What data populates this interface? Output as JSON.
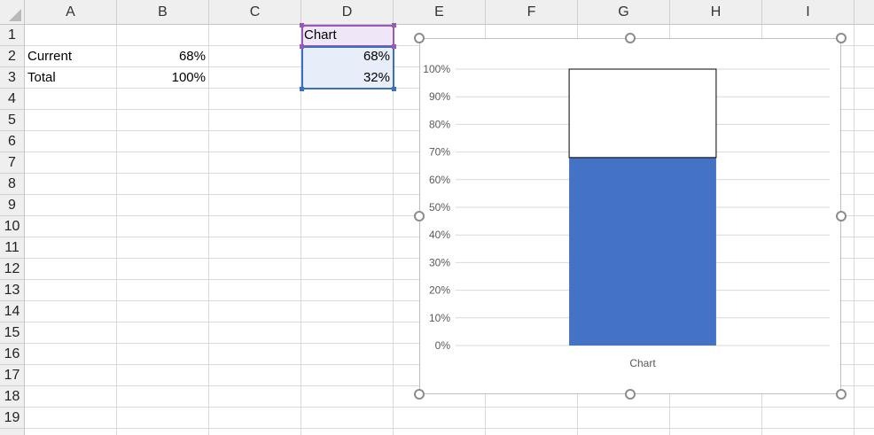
{
  "columns": [
    "A",
    "B",
    "C",
    "D",
    "E",
    "F",
    "G",
    "H",
    "I"
  ],
  "rows": [
    "1",
    "2",
    "3",
    "4",
    "5",
    "6",
    "7",
    "8",
    "9",
    "10",
    "11",
    "12",
    "13",
    "14",
    "15",
    "16",
    "17",
    "18",
    "19"
  ],
  "cells": {
    "A2": "Current",
    "B2": "68%",
    "A3": "Total",
    "B3": "100%",
    "D1": "Chart",
    "D2": "68%",
    "D3": "32%"
  },
  "colors": {
    "series_fill": "#4472c4",
    "remainder_fill": "#ffffff",
    "header_bg": "#efefef",
    "selection_purple": "#9b59b6",
    "selection_blue": "#3a6fc4"
  },
  "chart_data": {
    "type": "bar",
    "stacked": true,
    "categories": [
      "Chart"
    ],
    "series": [
      {
        "values": [
          0.68
        ],
        "color": "#4472c4"
      },
      {
        "values": [
          0.32
        ],
        "color": "#ffffff"
      }
    ],
    "ylim": [
      0,
      1
    ],
    "y_ticks": [
      "0%",
      "10%",
      "20%",
      "30%",
      "40%",
      "50%",
      "60%",
      "70%",
      "80%",
      "90%",
      "100%"
    ],
    "grid": true,
    "legend": "none"
  }
}
